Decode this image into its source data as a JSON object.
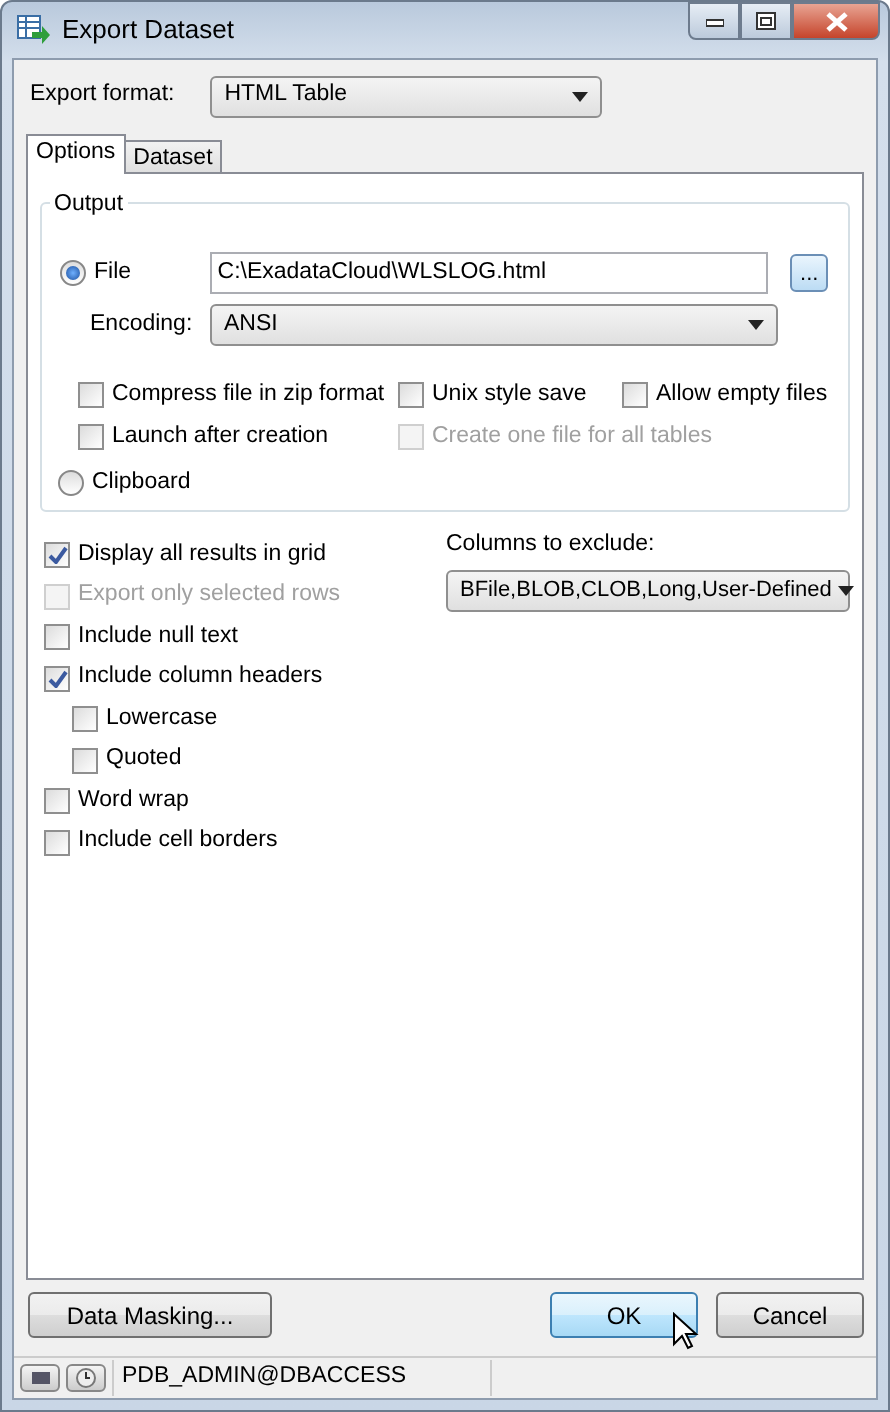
{
  "window": {
    "title": "Export Dataset"
  },
  "export_format": {
    "label": "Export format:",
    "value": "HTML Table"
  },
  "tabs": [
    {
      "label": "Options",
      "selected": true
    },
    {
      "label": "Dataset",
      "selected": false
    }
  ],
  "output": {
    "title": "Output",
    "file": {
      "label": "File",
      "selected": true,
      "path": "C:\\ExadataCloud\\WLSLOG.html",
      "browse": "..."
    },
    "encoding": {
      "label": "Encoding:",
      "value": "ANSI"
    },
    "options": [
      {
        "label": "Compress file in zip format",
        "checked": false,
        "disabled": false
      },
      {
        "label": "Unix style save",
        "checked": false,
        "disabled": false
      },
      {
        "label": "Allow empty files",
        "checked": false,
        "disabled": false
      },
      {
        "label": "Launch after creation",
        "checked": false,
        "disabled": false
      },
      {
        "label": "Create one file for all tables",
        "checked": false,
        "disabled": true
      }
    ],
    "clipboard": {
      "label": "Clipboard",
      "selected": false
    }
  },
  "options": [
    {
      "label": "Display all results in grid",
      "checked": true,
      "disabled": false
    },
    {
      "label": "Export only selected rows",
      "checked": false,
      "disabled": true
    },
    {
      "label": "Include null text",
      "checked": false,
      "disabled": false
    },
    {
      "label": "Include column headers",
      "checked": true,
      "disabled": false,
      "children": [
        {
          "label": "Lowercase",
          "checked": false,
          "disabled": false
        },
        {
          "label": "Quoted",
          "checked": false,
          "disabled": false
        }
      ]
    },
    {
      "label": "Word wrap",
      "checked": false,
      "disabled": false
    },
    {
      "label": "Include cell borders",
      "checked": false,
      "disabled": false
    }
  ],
  "columns_to_exclude": {
    "label": "Columns to exclude:",
    "value": "BFile,BLOB,CLOB,Long,User-Defined"
  },
  "buttons": [
    {
      "label": "Data Masking...",
      "highlighted": false
    },
    {
      "label": "OK",
      "highlighted": true
    },
    {
      "label": "Cancel",
      "highlighted": false
    }
  ],
  "status_bar": {
    "user": "PDB_ADMIN@DBACCESS"
  }
}
